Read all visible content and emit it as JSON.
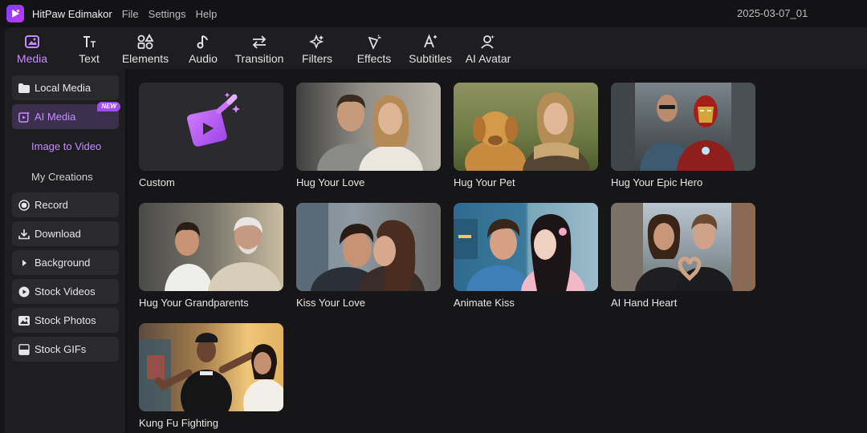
{
  "app": {
    "title": "HitPaw Edimakor",
    "menu": [
      "File",
      "Settings",
      "Help"
    ],
    "project_name": "2025-03-07_01"
  },
  "toolbar": {
    "tabs": [
      {
        "label": "Media",
        "icon": "media-icon",
        "active": true
      },
      {
        "label": "Text",
        "icon": "text-icon",
        "active": false
      },
      {
        "label": "Elements",
        "icon": "elements-icon",
        "active": false
      },
      {
        "label": "Audio",
        "icon": "audio-icon",
        "active": false
      },
      {
        "label": "Transition",
        "icon": "transition-icon",
        "active": false
      },
      {
        "label": "Filters",
        "icon": "filters-icon",
        "active": false
      },
      {
        "label": "Effects",
        "icon": "effects-icon",
        "active": false
      },
      {
        "label": "Subtitles",
        "icon": "subtitles-icon",
        "active": false
      },
      {
        "label": "AI Avatar",
        "icon": "ai-avatar-icon",
        "active": false
      }
    ]
  },
  "sidebar": {
    "items": [
      {
        "label": "Local Media",
        "icon": "folder-icon"
      },
      {
        "label": "AI Media",
        "icon": "ai-media-icon",
        "badge": "NEW",
        "active": true
      },
      {
        "label": "Record",
        "icon": "record-icon"
      },
      {
        "label": "Download",
        "icon": "download-icon"
      },
      {
        "label": "Background",
        "icon": "triangle-right-icon"
      },
      {
        "label": "Stock Videos",
        "icon": "play-circle-icon"
      },
      {
        "label": "Stock Photos",
        "icon": "photo-icon"
      },
      {
        "label": "Stock GIFs",
        "icon": "gif-icon"
      }
    ],
    "sub_items": [
      {
        "label": "Image to Video",
        "active": true
      },
      {
        "label": "My Creations",
        "active": false
      }
    ]
  },
  "templates": [
    {
      "label": "Custom"
    },
    {
      "label": "Hug Your Love"
    },
    {
      "label": "Hug Your Pet"
    },
    {
      "label": "Hug Your Epic Hero"
    },
    {
      "label": "Hug Your Grandparents"
    },
    {
      "label": "Kiss Your Love"
    },
    {
      "label": "Animate Kiss"
    },
    {
      "label": "AI Hand Heart"
    },
    {
      "label": "Kung Fu Fighting"
    }
  ],
  "colors": {
    "accent": "#c68cff",
    "badge": "#a24cf0",
    "panel": "#1e1e21",
    "background": "#161618"
  }
}
